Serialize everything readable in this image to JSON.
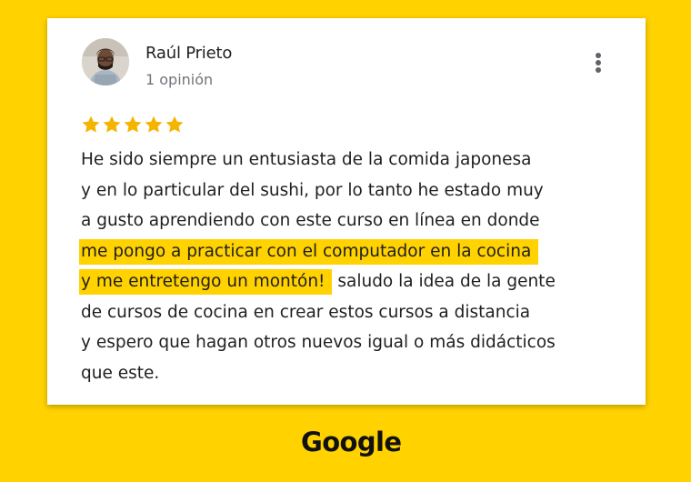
{
  "review": {
    "reviewer_name": "Raúl Prieto",
    "review_count_label": "1 opinión",
    "rating": 5,
    "rating_max": 5,
    "star_color": "#f4b400",
    "highlight_color": "#ffd200",
    "lines": [
      {
        "before": "He sido siempre un entusiasta de la comida japonesa",
        "highlight": "",
        "after": ""
      },
      {
        "before": "y en lo particular del sushi, por lo tanto he estado muy",
        "highlight": "",
        "after": ""
      },
      {
        "before": "a gusto aprendiendo con este curso en línea en donde",
        "highlight": "",
        "after": ""
      },
      {
        "before": "",
        "highlight": "me pongo a practicar con el computador en la cocina",
        "after": ""
      },
      {
        "before": "",
        "highlight": "y me entretengo un montón!",
        "after": " saludo la idea de la gente"
      },
      {
        "before": "de cursos de cocina en crear estos cursos a distancia",
        "highlight": "",
        "after": ""
      },
      {
        "before": "y espero que hagan otros nuevos igual o más didácticos",
        "highlight": "",
        "after": ""
      },
      {
        "before": "que este.",
        "highlight": "",
        "after": ""
      }
    ]
  },
  "icons": {
    "more": "more-vert-icon",
    "star": "star-icon",
    "avatar": "user-avatar"
  },
  "footer": {
    "brand": "Google"
  },
  "colors": {
    "background": "#ffd200",
    "card": "#ffffff",
    "text": "#1f1f1f",
    "secondary_text": "#70757a"
  }
}
